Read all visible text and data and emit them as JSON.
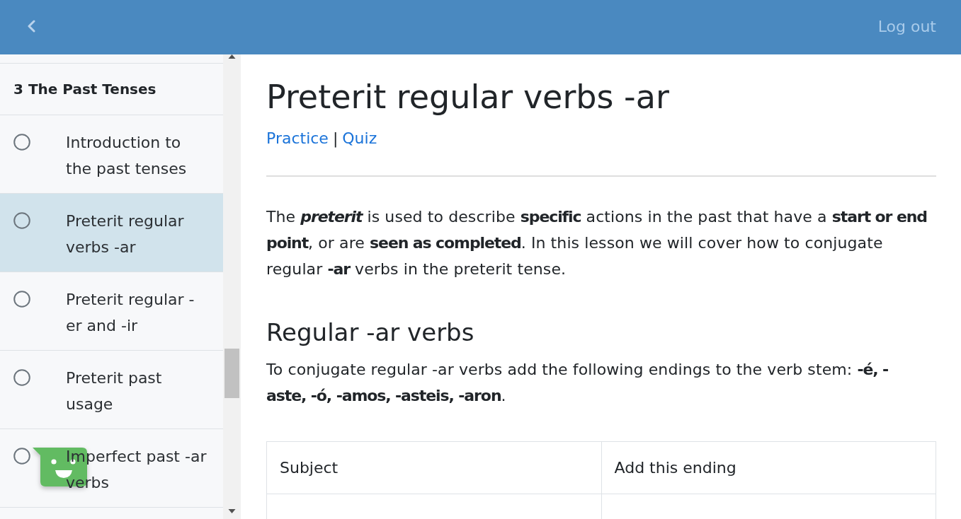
{
  "header": {
    "action": "Log out"
  },
  "sidebar": {
    "section": "3 The Past Tenses",
    "items": [
      {
        "label": "Introduction to the past tenses",
        "selected": false,
        "done": false
      },
      {
        "label": "Preterit regular verbs -ar",
        "selected": true,
        "done": false
      },
      {
        "label": "Preterit regular -er and -ir",
        "selected": false,
        "done": false
      },
      {
        "label": "Preterit past usage",
        "selected": false,
        "done": false
      },
      {
        "label": "Imperfect past -ar verbs",
        "selected": false,
        "done": false
      }
    ]
  },
  "lesson": {
    "title": "Preterit regular verbs -ar",
    "links": [
      "Practice",
      "Quiz"
    ],
    "link_separator": "|",
    "intro": "The *preterit* is used to describe **specific** actions in the past that have a **start or end point**, or are **seen as completed**. In this lesson we will cover how to conjugate regular **-ar** verbs in the preterit tense.",
    "section_title": "Regular -ar verbs",
    "section_text": "To conjugate regular -ar verbs add the following endings to the verb stem: **-é, -aste, -ó, -amos, -asteis, -aron**.",
    "table": {
      "columns": [
        "Subject",
        "Add this ending"
      ]
    }
  }
}
